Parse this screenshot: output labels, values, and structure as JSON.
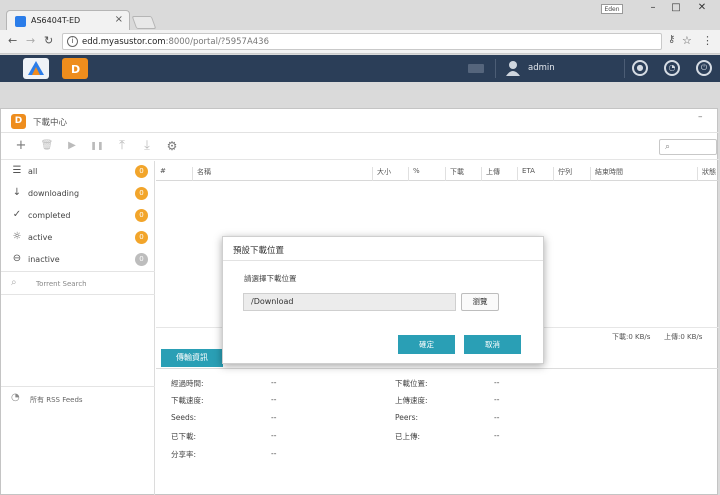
{
  "browser": {
    "tab_title": "AS6404T-ED",
    "tab_close": "×",
    "user_chip": "Eden",
    "window_buttons": [
      "–",
      "□",
      "✕"
    ],
    "nav": {
      "back": "←",
      "forward": "→",
      "reload": "↻"
    },
    "url_host": "edd.myasustor.com",
    "url_rest": ":8000/portal/?5957A436",
    "address_icons": {
      "key": "⚷",
      "star": "☆",
      "menu": "⋮"
    }
  },
  "adm_bar": {
    "user_name": "admin"
  },
  "app": {
    "title": "下載中心",
    "icon_letter": "D",
    "minimize": "–",
    "toolbar_icons": [
      "+",
      "🗑",
      "▶",
      "❚❚",
      "⤒",
      "⤓",
      "⚙"
    ],
    "search_icon": "⌕"
  },
  "sidebar": {
    "categories": [
      {
        "label": "all",
        "icon": "☰",
        "count": "0"
      },
      {
        "label": "downloading",
        "icon": "↓",
        "count": "0"
      },
      {
        "label": "completed",
        "icon": "✓",
        "count": "0"
      },
      {
        "label": "active",
        "icon": "☼",
        "count": "0"
      },
      {
        "label": "inactive",
        "icon": "⊖",
        "count": "0"
      }
    ],
    "search_icon": "⌕",
    "search_placeholder": "Torrent Search",
    "rss_icon": "◔",
    "rss_label": "所有 RSS Feeds"
  },
  "list": {
    "columns": [
      "#",
      "名稱",
      "大小",
      "%",
      "下載",
      "上傳",
      "ETA",
      "佇列",
      "結束時間",
      "狀態"
    ]
  },
  "status_bar": {
    "download": "下載:0 KB/s",
    "upload": "上傳:0 KB/s"
  },
  "details": {
    "tab_label": "傳輸資訊",
    "left": [
      {
        "label": "經過時間:",
        "value": "--"
      },
      {
        "label": "下載速度:",
        "value": "--"
      },
      {
        "label": "Seeds:",
        "value": "--"
      },
      {
        "label": "已下載:",
        "value": "--"
      },
      {
        "label": "分享率:",
        "value": "--"
      }
    ],
    "right": [
      {
        "label": "下載位置:",
        "value": "--"
      },
      {
        "label": "上傳速度:",
        "value": "--"
      },
      {
        "label": "Peers:",
        "value": "--"
      },
      {
        "label": "已上傳:",
        "value": "--"
      }
    ]
  },
  "modal": {
    "title": "預設下載位置",
    "prompt": "請選擇下載位置",
    "path_value": "/Download",
    "browse_label": "瀏覽",
    "ok_label": "確定",
    "cancel_label": "取消"
  },
  "colors": {
    "accent": "#2a9fb5",
    "badge": "#f2a52b",
    "adm_bar": "#2b3e58",
    "app_icon": "#ee8d1d"
  }
}
